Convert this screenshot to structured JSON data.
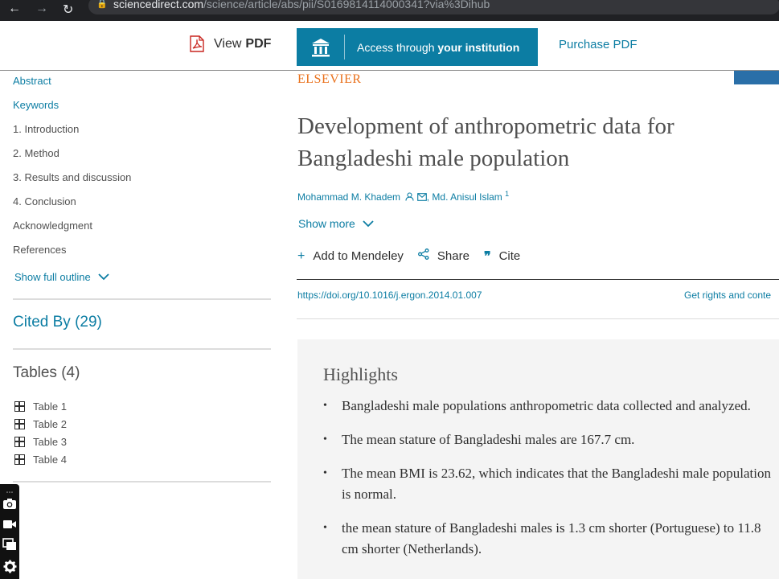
{
  "browser": {
    "url_host": "sciencedirect.com",
    "url_path": "/science/article/abs/pii/S0169814114000341?via%3Dihub"
  },
  "toolbar": {
    "view_pdf_prefix": "View",
    "view_pdf_bold": "PDF",
    "access_prefix": "Access through",
    "access_bold": "your institution",
    "purchase_pdf": "Purchase PDF"
  },
  "sidebar": {
    "outline": [
      {
        "label": "Abstract"
      },
      {
        "label": "Keywords"
      },
      {
        "label": "1. Introduction"
      },
      {
        "label": "2. Method"
      },
      {
        "label": "3. Results and discussion"
      },
      {
        "label": "4. Conclusion"
      },
      {
        "label": "Acknowledgment"
      },
      {
        "label": "References"
      }
    ],
    "show_full_outline": "Show full outline",
    "cited_by": "Cited By (29)",
    "tables_heading": "Tables (4)",
    "tables": [
      "Table 1",
      "Table 2",
      "Table 3",
      "Table 4"
    ]
  },
  "article": {
    "publisher": "ELSEVIER",
    "title": "Development of anthropometric data for Bangladeshi male population",
    "author1": "Mohammad M. Khadem",
    "author_sep": ", ",
    "author2": "Md. Anisul Islam",
    "author2_sup": "1",
    "show_more": "Show more",
    "actions": {
      "mendeley": "Add to Mendeley",
      "share": "Share",
      "cite": "Cite"
    },
    "doi": "https://doi.org/10.1016/j.ergon.2014.01.007",
    "rights": "Get rights and conte"
  },
  "highlights": {
    "heading": "Highlights",
    "items": [
      "Bangladeshi male populations anthropometric data collected and analyzed.",
      "The mean stature of Bangladeshi males are 167.7 cm.",
      "The mean BMI is 23.62, which indicates that the Bangladeshi male population is normal.",
      "the mean stature of Bangladeshi males is 1.3 cm shorter (Portuguese) to 11.8 cm shorter (Netherlands)."
    ]
  },
  "colors": {
    "accent": "#0c7da3",
    "publisher_orange": "#e9711c",
    "highlight_bg": "#f4f4f4"
  }
}
